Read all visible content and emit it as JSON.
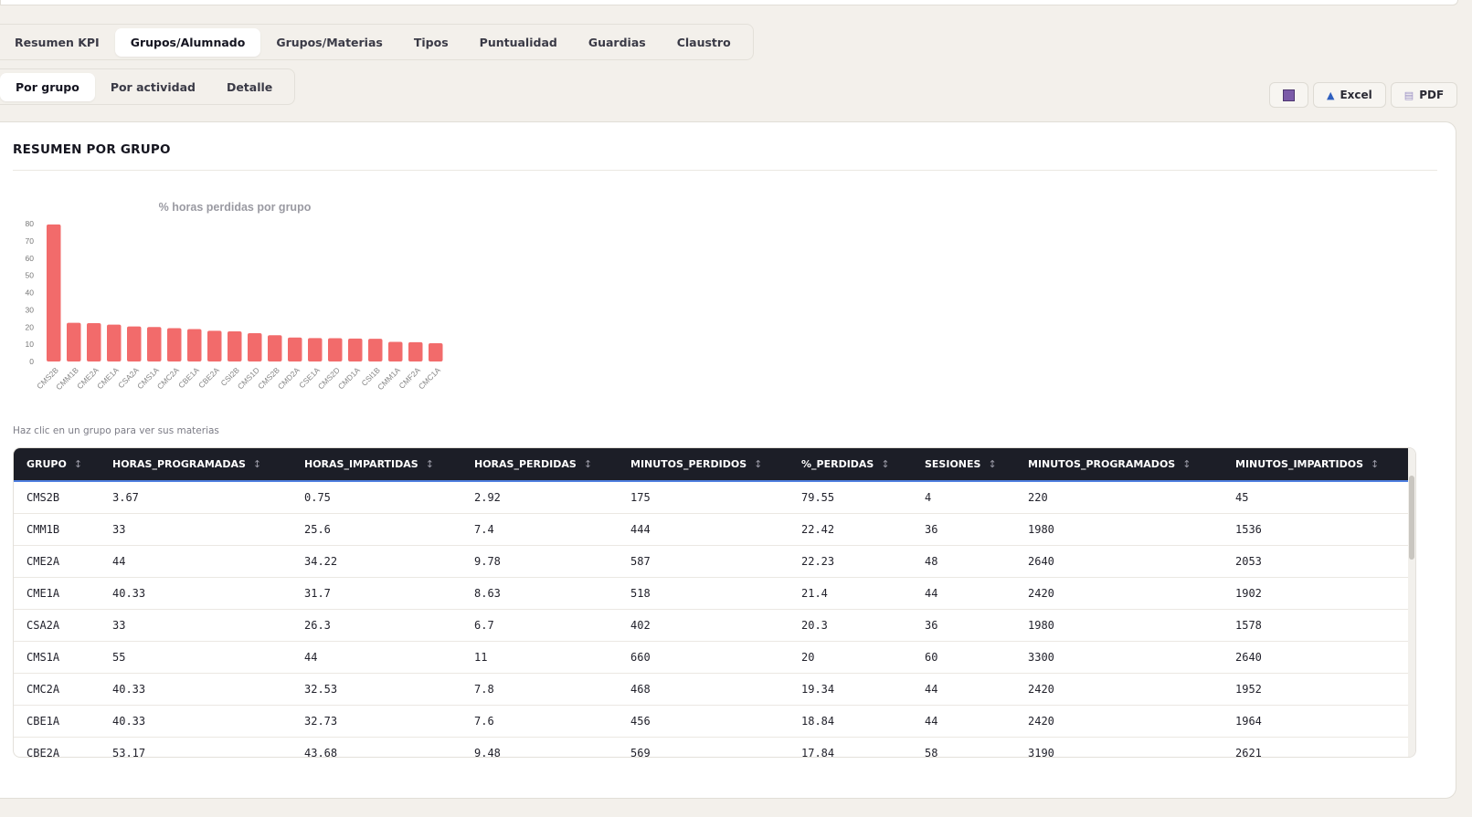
{
  "main_tabs": [
    {
      "label": "Resumen KPI",
      "active": false
    },
    {
      "label": "Grupos/Alumnado",
      "active": true
    },
    {
      "label": "Grupos/Materias",
      "active": false
    },
    {
      "label": "Tipos",
      "active": false
    },
    {
      "label": "Puntualidad",
      "active": false
    },
    {
      "label": "Guardias",
      "active": false
    },
    {
      "label": "Claustro",
      "active": false
    }
  ],
  "sub_tabs": [
    {
      "label": "Por grupo",
      "active": true
    },
    {
      "label": "Por actividad",
      "active": false
    },
    {
      "label": "Detalle",
      "active": false
    }
  ],
  "actions": {
    "image_icon": "square-icon",
    "excel_label": "Excel",
    "pdf_label": "PDF"
  },
  "section": {
    "title": "RESUMEN POR GRUPO",
    "hint": "Haz clic en un grupo para ver sus materias"
  },
  "chart_data": {
    "type": "bar",
    "title": "% horas perdidas por grupo",
    "categories": [
      "CMS2B",
      "CMM1B",
      "CME2A",
      "CME1A",
      "CSA2A",
      "CMS1A",
      "CMC2A",
      "CBE1A",
      "CBE2A",
      "CSI2B",
      "CMS1D",
      "CMS2B",
      "CMD2A",
      "CSE1A",
      "CMS2D",
      "CMD1A",
      "CSI1B",
      "CMM1A",
      "CMF2A",
      "CMC1A"
    ],
    "values": [
      79.55,
      22.42,
      22.23,
      21.4,
      20.3,
      20,
      19.34,
      18.84,
      17.84,
      17.5,
      16.4,
      15.2,
      13.9,
      13.6,
      13.5,
      13.3,
      13.2,
      11.4,
      11.2,
      10.6
    ],
    "yticks": [
      0,
      10,
      20,
      30,
      40,
      50,
      60,
      70,
      80
    ],
    "ylim": [
      0,
      80
    ],
    "bar_color": "#f26b6b"
  },
  "table": {
    "columns": [
      "GRUPO",
      "HORAS_PROGRAMADAS",
      "HORAS_IMPARTIDAS",
      "HORAS_PERDIDAS",
      "MINUTOS_PERDIDOS",
      "%_PERDIDAS",
      "SESIONES",
      "MINUTOS_PROGRAMADOS",
      "MINUTOS_IMPARTIDOS"
    ],
    "sort_icon": "↕",
    "rows": [
      [
        "CMS2B",
        "3.67",
        "0.75",
        "2.92",
        "175",
        "79.55",
        "4",
        "220",
        "45"
      ],
      [
        "CMM1B",
        "33",
        "25.6",
        "7.4",
        "444",
        "22.42",
        "36",
        "1980",
        "1536"
      ],
      [
        "CME2A",
        "44",
        "34.22",
        "9.78",
        "587",
        "22.23",
        "48",
        "2640",
        "2053"
      ],
      [
        "CME1A",
        "40.33",
        "31.7",
        "8.63",
        "518",
        "21.4",
        "44",
        "2420",
        "1902"
      ],
      [
        "CSA2A",
        "33",
        "26.3",
        "6.7",
        "402",
        "20.3",
        "36",
        "1980",
        "1578"
      ],
      [
        "CMS1A",
        "55",
        "44",
        "11",
        "660",
        "20",
        "60",
        "3300",
        "2640"
      ],
      [
        "CMC2A",
        "40.33",
        "32.53",
        "7.8",
        "468",
        "19.34",
        "44",
        "2420",
        "1952"
      ],
      [
        "CBE1A",
        "40.33",
        "32.73",
        "7.6",
        "456",
        "18.84",
        "44",
        "2420",
        "1964"
      ],
      [
        "CBE2A",
        "53.17",
        "43.68",
        "9.48",
        "569",
        "17.84",
        "58",
        "3190",
        "2621"
      ]
    ]
  }
}
